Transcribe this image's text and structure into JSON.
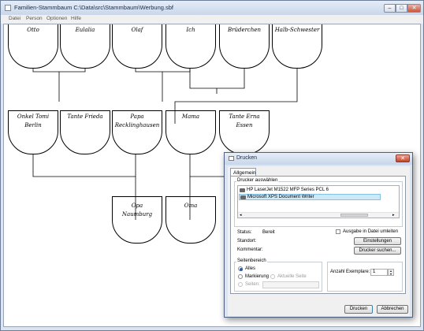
{
  "window": {
    "title": "Familien-Stammbaum C:\\Data\\src\\Stammbaum\\Werbung.sbf",
    "controls": {
      "minimize": "–",
      "maximize": "□",
      "close": "✕"
    }
  },
  "menu": [
    "Datei",
    "Person",
    "Optionen",
    "Hilfe"
  ],
  "tree": {
    "top_row": [
      "Otto",
      "Eulalia",
      "Olaf",
      "Ich",
      "Brüderchen",
      "Halb-Schwester"
    ],
    "middle_row": [
      {
        "line1": "Onkel Tomi",
        "line2": "Berlin"
      },
      {
        "line1": "Tante Frieda",
        "line2": ""
      },
      {
        "line1": "Papa",
        "line2": "Recklinghausen"
      },
      {
        "line1": "Mama",
        "line2": ""
      },
      {
        "line1": "Tante Erna",
        "line2": "Essen"
      }
    ],
    "bottom_row": [
      {
        "line1": "Opa",
        "line2": "Naumburg"
      },
      {
        "line1": "Oma",
        "line2": ""
      }
    ]
  },
  "print_dialog": {
    "title": "Drucken",
    "close": "✕",
    "tab": "Allgemein",
    "printer_group": "Drucker auswählen",
    "printers": [
      "HP LaserJet M1522 MFP Series PCL 6",
      "Microsoft XPS Document Writer"
    ],
    "status_label": "Status:",
    "status_value": "Bereit",
    "location_label": "Standort:",
    "comment_label": "Kommentar:",
    "print_to_file": "Ausgabe in Datei umleiten",
    "settings_button": "Einstellungen",
    "find_printer_button": "Drucker suchen...",
    "range_group": "Seitenbereich",
    "range_all": "Alles",
    "range_selection": "Markierung",
    "range_current": "Aktuelle Seite",
    "range_pages": "Seiten:",
    "copies_label": "Anzahl Exemplare:",
    "copies_value": "1",
    "print_button": "Drucken",
    "cancel_button": "Abbrechen"
  },
  "colors": {
    "selection": "#cde8f7",
    "accent": "#2b5ea7"
  }
}
